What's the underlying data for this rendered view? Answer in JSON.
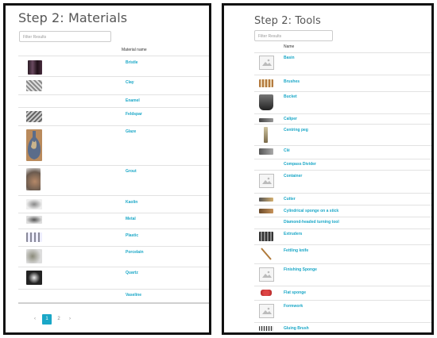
{
  "materials": {
    "title": "Step 2: Materials",
    "filter_placeholder": "Filter Results",
    "column_header": "Material name",
    "items": [
      {
        "name": "Bristle"
      },
      {
        "name": "Clay"
      },
      {
        "name": "Enamel"
      },
      {
        "name": "Feldspar"
      },
      {
        "name": "Glaze"
      },
      {
        "name": "Grout"
      },
      {
        "name": "Kaolin"
      },
      {
        "name": "Metal"
      },
      {
        "name": "Plastic"
      },
      {
        "name": "Porcelain"
      },
      {
        "name": "Quartz"
      },
      {
        "name": "Vaseline"
      }
    ],
    "pagination": {
      "prev": "‹",
      "current": "1",
      "next_page": "2",
      "next": "›"
    }
  },
  "tools": {
    "title": "Step 2: Tools",
    "filter_placeholder": "Filter Results",
    "column_header": "Name",
    "items": [
      {
        "name": "Basin"
      },
      {
        "name": "Brushes"
      },
      {
        "name": "Bucket"
      },
      {
        "name": "Caliper"
      },
      {
        "name": "Centring peg"
      },
      {
        "name": "Clé"
      },
      {
        "name": "Compass Divider"
      },
      {
        "name": "Container"
      },
      {
        "name": "Cutter"
      },
      {
        "name": "Cylindrical sponge on a stick"
      },
      {
        "name": "Diamond-headed turning tool"
      },
      {
        "name": "Extruders"
      },
      {
        "name": "Fettling knife"
      },
      {
        "name": "Finishing Sponge"
      },
      {
        "name": "Flat sponge"
      },
      {
        "name": "Formwork"
      },
      {
        "name": "Gluing Brush"
      }
    ]
  },
  "colors": {
    "accent": "#1aa7c7",
    "border": "#111111",
    "title": "#555555"
  }
}
